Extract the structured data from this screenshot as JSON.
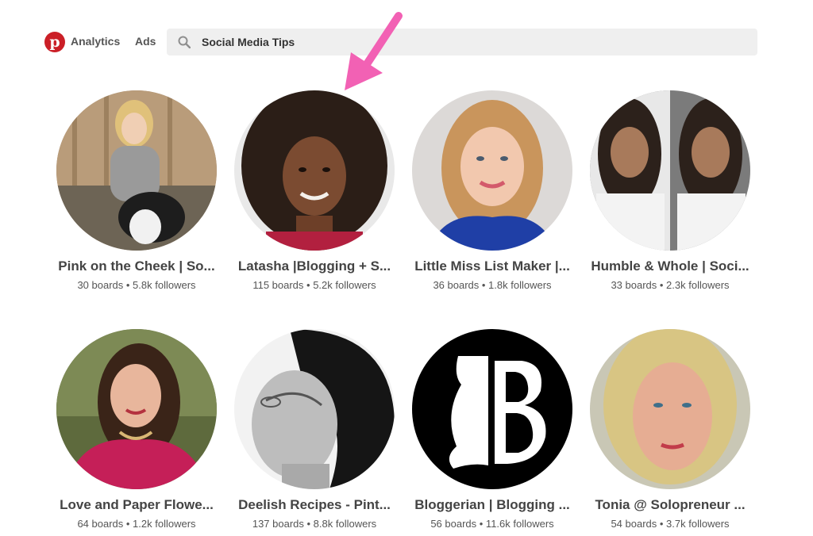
{
  "header": {
    "logo_letter": "p",
    "analytics_label": "Analytics",
    "ads_label": "Ads",
    "search": {
      "value": "Social Media Tips"
    }
  },
  "colors": {
    "brand": "#cb1f27",
    "arrow": "#f261b4"
  },
  "profiles": [
    {
      "name": "Pink on the Cheek | So...",
      "stats": "30 boards • 5.8k followers"
    },
    {
      "name": "Latasha |Blogging + S...",
      "stats": "115 boards • 5.2k followers"
    },
    {
      "name": "Little Miss List Maker |...",
      "stats": "36 boards • 1.8k followers"
    },
    {
      "name": "Humble & Whole | Soci...",
      "stats": "33 boards • 2.3k followers"
    },
    {
      "name": "Love and Paper Flowe...",
      "stats": "64 boards • 1.2k followers"
    },
    {
      "name": "Deelish Recipes - Pint...",
      "stats": "137 boards • 8.8k followers"
    },
    {
      "name": "Bloggerian | Blogging ...",
      "stats": "56 boards • 11.6k followers"
    },
    {
      "name": "Tonia @ Solopreneur ...",
      "stats": "54 boards • 3.7k followers"
    }
  ]
}
